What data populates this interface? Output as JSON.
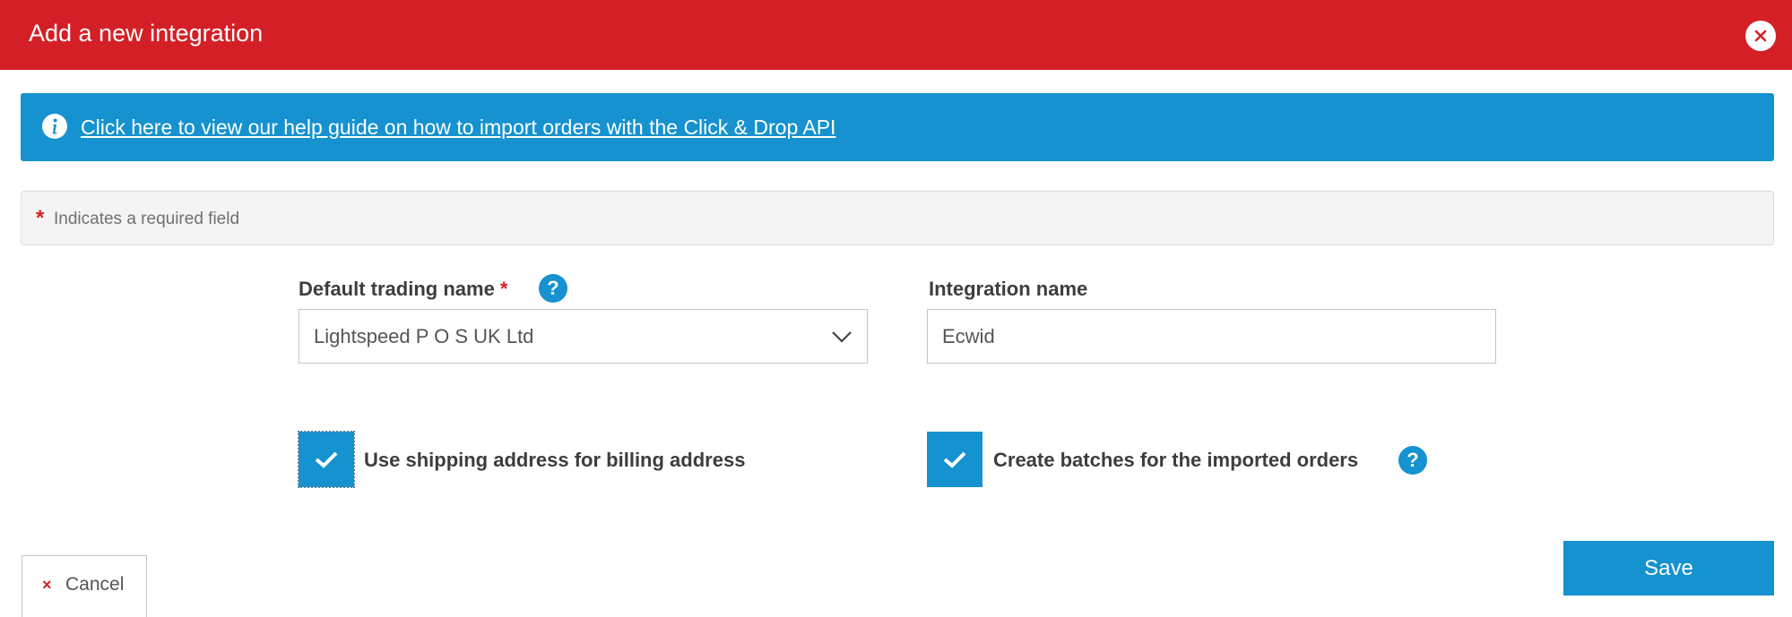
{
  "header": {
    "title": "Add a new integration",
    "close_icon": "close-icon"
  },
  "info_banner": {
    "icon": "info-icon",
    "link_text": "Click here to view our help guide on how to import orders with the Click & Drop API"
  },
  "required_note": {
    "star": "*",
    "text": "Indicates a required field"
  },
  "form": {
    "trading_name": {
      "label": "Default trading name",
      "required_star": "*",
      "help": "?",
      "value": "Lightspeed P O S UK Ltd"
    },
    "integration_name": {
      "label": "Integration name",
      "value": "Ecwid"
    },
    "use_shipping_checkbox": {
      "label": "Use shipping address for billing address",
      "checked": true
    },
    "create_batches_checkbox": {
      "label": "Create batches for the imported orders",
      "checked": true,
      "help": "?"
    }
  },
  "buttons": {
    "save_label": "Save",
    "cancel_label": "Cancel",
    "cancel_icon": "×"
  },
  "colors": {
    "header_red": "#d51f26",
    "accent_blue": "#1592cf"
  }
}
